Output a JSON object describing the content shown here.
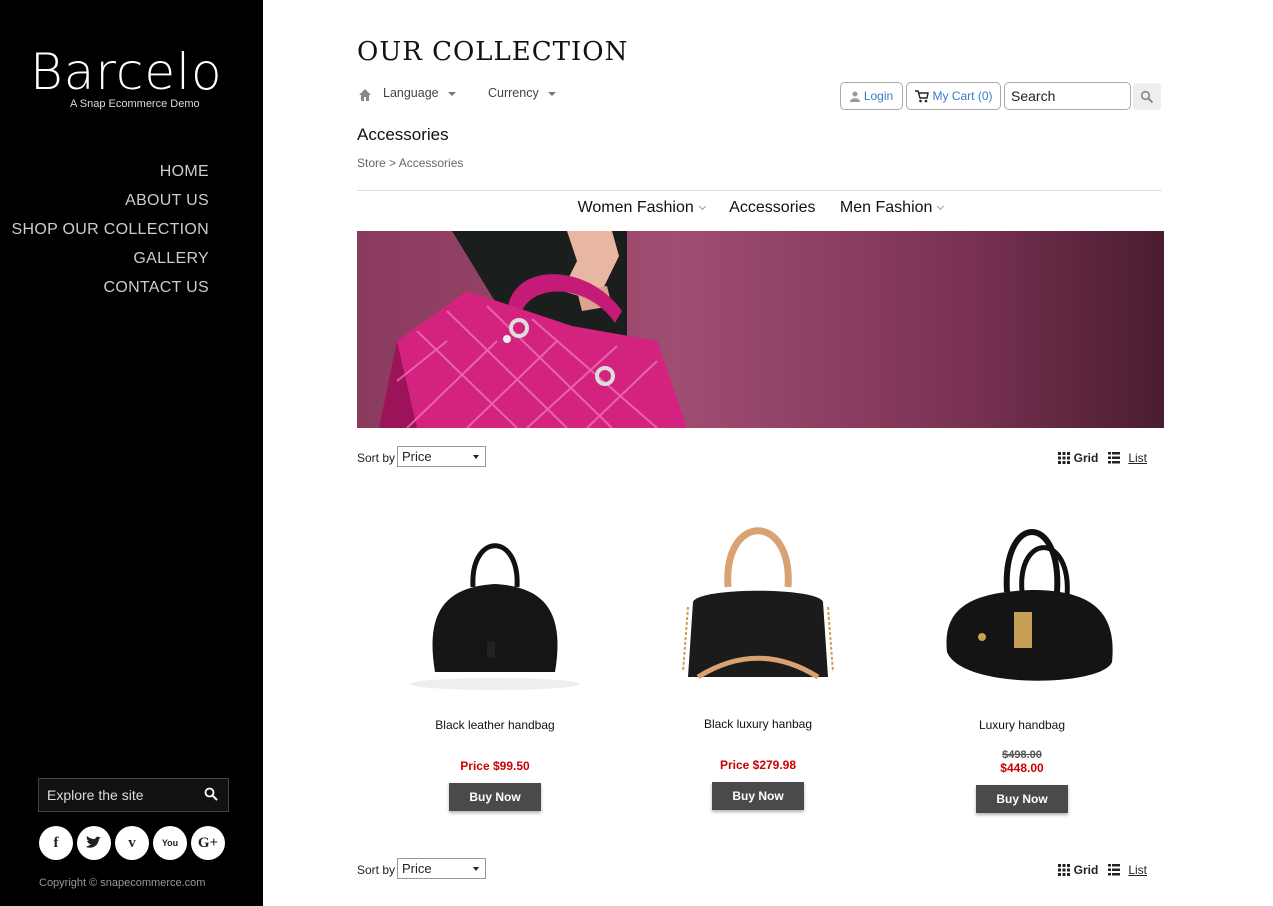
{
  "brand": {
    "name": "Barcelo",
    "tagline": "A Snap Ecommerce Demo"
  },
  "sidebar": {
    "nav": [
      "HOME",
      "ABOUT US",
      "SHOP OUR COLLECTION",
      "GALLERY",
      "CONTACT US"
    ],
    "search_placeholder": "Explore the site",
    "social_icons": [
      "facebook-icon",
      "twitter-icon",
      "vimeo-icon",
      "youtube-icon",
      "google-plus-icon"
    ],
    "social_glyphs": [
      "f",
      "t",
      "v",
      "You",
      "G+"
    ],
    "copyright": "Copyright © snapecommerce.com"
  },
  "header": {
    "title": "OUR COLLECTION",
    "language_label": "Language",
    "currency_label": "Currency",
    "login_label": "Login",
    "cart_label": "My Cart (0)",
    "search_placeholder": "Search"
  },
  "page": {
    "category_title": "Accessories",
    "breadcrumb": "Store > Accessories"
  },
  "category_nav": [
    {
      "label": "Women Fashion",
      "has_submenu": true
    },
    {
      "label": "Accessories",
      "has_submenu": false
    },
    {
      "label": "Men Fashion",
      "has_submenu": true
    }
  ],
  "listing": {
    "sort_label": "Sort by",
    "sort_value": "Price",
    "grid_label": "Grid",
    "list_label": "List"
  },
  "products": [
    {
      "name": "Black leather handbag",
      "price": "Price $99.50",
      "old_price": "",
      "buy_label": "Buy Now"
    },
    {
      "name": "Black luxury hanbag",
      "price": "Price $279.98",
      "old_price": "",
      "buy_label": "Buy Now"
    },
    {
      "name": "Luxury handbag",
      "price": "$448.00",
      "old_price": "$498.00",
      "buy_label": "Buy Now"
    }
  ],
  "colors": {
    "sidebar_bg": "#000000",
    "price_red": "#cc0000",
    "link_blue": "#3a7bc8",
    "buy_button": "#4a4a4a",
    "banner_bag": "#d3237f"
  }
}
